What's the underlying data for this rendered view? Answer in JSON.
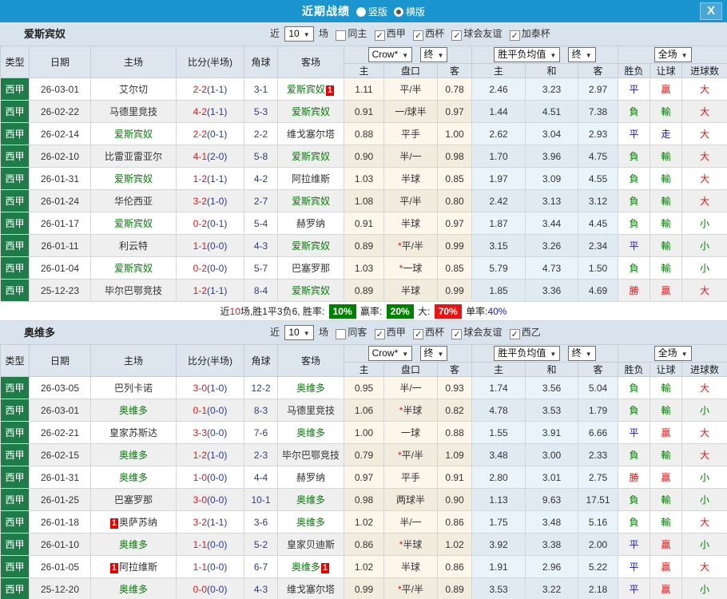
{
  "titlebar": {
    "title": "近期战绩",
    "radios": [
      {
        "label": "竖版",
        "checked": false
      },
      {
        "label": "横版",
        "checked": true
      }
    ],
    "close_label": "X"
  },
  "table_header": {
    "left_cols": [
      "类型",
      "日期",
      "主场",
      "比分(半场)",
      "角球",
      "客场"
    ],
    "odds_select": "Crow*",
    "odds_final_select": "终",
    "odds_cols": [
      "主",
      "盘口",
      "客"
    ],
    "avg_select": "胜平负均值",
    "avg_final_select": "终",
    "avg_cols": [
      "主",
      "和",
      "客"
    ],
    "result_select": "全场",
    "result_cols": [
      "胜负",
      "让球",
      "进球数"
    ]
  },
  "sections": [
    {
      "team": "爱斯宾奴",
      "near": "近",
      "count": "10",
      "unit": "场",
      "venue_filter": {
        "label": "同主",
        "checked": false
      },
      "filters": [
        {
          "label": "西甲",
          "checked": true
        },
        {
          "label": "西杯",
          "checked": true
        },
        {
          "label": "球会友谊",
          "checked": true
        },
        {
          "label": "加泰杯",
          "checked": true
        }
      ],
      "rows": [
        {
          "lg": "西甲",
          "date": "26-03-01",
          "home": "艾尔切",
          "hb": 0,
          "score": "2-2",
          "half": "(1-1)",
          "ck": "3-1",
          "away": "爱斯宾奴",
          "ab": 1,
          "o1": "1.11",
          "hc": "平/半",
          "o2": "0.78",
          "a1": "2.46",
          "a2": "3.23",
          "a3": "2.97",
          "r": "平",
          "l": "贏",
          "g": "大"
        },
        {
          "lg": "西甲",
          "date": "26-02-22",
          "home": "马德里竞技",
          "hb": 0,
          "score": "4-2",
          "half": "(1-1)",
          "ck": "5-3",
          "away": "爱斯宾奴",
          "ab": 0,
          "o1": "0.91",
          "hc": "一/球半",
          "o2": "0.97",
          "a1": "1.44",
          "a2": "4.51",
          "a3": "7.38",
          "r": "負",
          "l": "輸",
          "g": "大"
        },
        {
          "lg": "西甲",
          "date": "26-02-14",
          "home": "爱斯宾奴",
          "hb": 0,
          "score": "2-2",
          "half": "(0-1)",
          "ck": "2-2",
          "away": "维戈塞尔塔",
          "ab": 0,
          "o1": "0.88",
          "hc": "平手",
          "o2": "1.00",
          "a1": "2.62",
          "a2": "3.04",
          "a3": "2.93",
          "r": "平",
          "l": "走",
          "g": "大"
        },
        {
          "lg": "西甲",
          "date": "26-02-10",
          "home": "比雷亚雷亚尔",
          "hb": 0,
          "score": "4-1",
          "half": "(2-0)",
          "ck": "5-8",
          "away": "爱斯宾奴",
          "ab": 0,
          "o1": "0.90",
          "hc": "半/一",
          "o2": "0.98",
          "a1": "1.70",
          "a2": "3.96",
          "a3": "4.75",
          "r": "負",
          "l": "輸",
          "g": "大"
        },
        {
          "lg": "西甲",
          "date": "26-01-31",
          "home": "爱斯宾奴",
          "hb": 0,
          "score": "1-2",
          "half": "(1-1)",
          "ck": "4-2",
          "away": "阿拉维斯",
          "ab": 0,
          "o1": "1.03",
          "hc": "半球",
          "o2": "0.85",
          "a1": "1.97",
          "a2": "3.09",
          "a3": "4.55",
          "r": "負",
          "l": "輸",
          "g": "大"
        },
        {
          "lg": "西甲",
          "date": "26-01-24",
          "home": "华伦西亚",
          "hb": 0,
          "score": "3-2",
          "half": "(1-0)",
          "ck": "2-7",
          "away": "爱斯宾奴",
          "ab": 0,
          "o1": "1.08",
          "hc": "平/半",
          "o2": "0.80",
          "a1": "2.42",
          "a2": "3.13",
          "a3": "3.12",
          "r": "負",
          "l": "輸",
          "g": "大"
        },
        {
          "lg": "西甲",
          "date": "26-01-17",
          "home": "爱斯宾奴",
          "hb": 0,
          "score": "0-2",
          "half": "(0-1)",
          "ck": "5-4",
          "away": "赫罗纳",
          "ab": 0,
          "o1": "0.91",
          "hc": "半球",
          "o2": "0.97",
          "a1": "1.87",
          "a2": "3.44",
          "a3": "4.45",
          "r": "負",
          "l": "輸",
          "g": "小"
        },
        {
          "lg": "西甲",
          "date": "26-01-11",
          "home": "利云特",
          "hb": 0,
          "score": "1-1",
          "half": "(0-0)",
          "ck": "4-3",
          "away": "爱斯宾奴",
          "ab": 0,
          "o1": "0.89",
          "hc": "*平/半",
          "o2": "0.99",
          "a1": "3.15",
          "a2": "3.26",
          "a3": "2.34",
          "r": "平",
          "l": "輸",
          "g": "小"
        },
        {
          "lg": "西甲",
          "date": "26-01-04",
          "home": "爱斯宾奴",
          "hb": 0,
          "score": "0-2",
          "half": "(0-0)",
          "ck": "5-7",
          "away": "巴塞罗那",
          "ab": 0,
          "o1": "1.03",
          "hc": "*一球",
          "o2": "0.85",
          "a1": "5.79",
          "a2": "4.73",
          "a3": "1.50",
          "r": "負",
          "l": "輸",
          "g": "小"
        },
        {
          "lg": "西甲",
          "date": "25-12-23",
          "home": "毕尔巴鄂竞技",
          "hb": 0,
          "score": "1-2",
          "half": "(1-1)",
          "ck": "8-4",
          "away": "爱斯宾奴",
          "ab": 0,
          "o1": "0.89",
          "hc": "半球",
          "o2": "0.99",
          "a1": "1.85",
          "a2": "3.36",
          "a3": "4.69",
          "r": "勝",
          "l": "贏",
          "g": "大"
        }
      ],
      "footer": {
        "p1": "近",
        "n": "10",
        "p2": "场,胜1平3负6, 胜率:",
        "win": "10%",
        "p3": "赢率:",
        "yld": "20%",
        "p4": "大:",
        "big": "70%",
        "p5": "单率:",
        "single": "40%"
      }
    },
    {
      "team": "奥维多",
      "near": "近",
      "count": "10",
      "unit": "场",
      "venue_filter": {
        "label": "同客",
        "checked": false
      },
      "filters": [
        {
          "label": "西甲",
          "checked": true
        },
        {
          "label": "西杯",
          "checked": true
        },
        {
          "label": "球会友谊",
          "checked": true
        },
        {
          "label": "西乙",
          "checked": true
        }
      ],
      "rows": [
        {
          "lg": "西甲",
          "date": "26-03-05",
          "home": "巴列卡诺",
          "hb": 0,
          "score": "3-0",
          "half": "(1-0)",
          "ck": "12-2",
          "away": "奥维多",
          "ab": 0,
          "o1": "0.95",
          "hc": "半/一",
          "o2": "0.93",
          "a1": "1.74",
          "a2": "3.56",
          "a3": "5.04",
          "r": "負",
          "l": "輸",
          "g": "大"
        },
        {
          "lg": "西甲",
          "date": "26-03-01",
          "home": "奥维多",
          "hb": 0,
          "score": "0-1",
          "half": "(0-0)",
          "ck": "8-3",
          "away": "马德里竞技",
          "ab": 0,
          "o1": "1.06",
          "hc": "*半球",
          "o2": "0.82",
          "a1": "4.78",
          "a2": "3.53",
          "a3": "1.79",
          "r": "負",
          "l": "輸",
          "g": "小"
        },
        {
          "lg": "西甲",
          "date": "26-02-21",
          "home": "皇家苏斯达",
          "hb": 0,
          "score": "3-3",
          "half": "(0-0)",
          "ck": "7-6",
          "away": "奥维多",
          "ab": 0,
          "o1": "1.00",
          "hc": "一球",
          "o2": "0.88",
          "a1": "1.55",
          "a2": "3.91",
          "a3": "6.66",
          "r": "平",
          "l": "贏",
          "g": "大"
        },
        {
          "lg": "西甲",
          "date": "26-02-15",
          "home": "奥维多",
          "hb": 0,
          "score": "1-2",
          "half": "(1-0)",
          "ck": "2-3",
          "away": "毕尔巴鄂竞技",
          "ab": 0,
          "o1": "0.79",
          "hc": "*平/半",
          "o2": "1.09",
          "a1": "3.48",
          "a2": "3.00",
          "a3": "2.33",
          "r": "負",
          "l": "輸",
          "g": "大"
        },
        {
          "lg": "西甲",
          "date": "26-01-31",
          "home": "奥维多",
          "hb": 0,
          "score": "1-0",
          "half": "(0-0)",
          "ck": "4-4",
          "away": "赫罗纳",
          "ab": 0,
          "o1": "0.97",
          "hc": "平手",
          "o2": "0.91",
          "a1": "2.80",
          "a2": "3.01",
          "a3": "2.75",
          "r": "勝",
          "l": "贏",
          "g": "小"
        },
        {
          "lg": "西甲",
          "date": "26-01-25",
          "home": "巴塞罗那",
          "hb": 0,
          "score": "3-0",
          "half": "(0-0)",
          "ck": "10-1",
          "away": "奥维多",
          "ab": 0,
          "o1": "0.98",
          "hc": "两球半",
          "o2": "0.90",
          "a1": "1.13",
          "a2": "9.63",
          "a3": "17.51",
          "r": "負",
          "l": "輸",
          "g": "小"
        },
        {
          "lg": "西甲",
          "date": "26-01-18",
          "home": "奥萨苏纳",
          "hb": 1,
          "score": "3-2",
          "half": "(1-1)",
          "ck": "3-6",
          "away": "奥维多",
          "ab": 0,
          "o1": "1.02",
          "hc": "半/一",
          "o2": "0.86",
          "a1": "1.75",
          "a2": "3.48",
          "a3": "5.16",
          "r": "負",
          "l": "輸",
          "g": "大"
        },
        {
          "lg": "西甲",
          "date": "26-01-10",
          "home": "奥维多",
          "hb": 0,
          "score": "1-1",
          "half": "(0-0)",
          "ck": "5-2",
          "away": "皇家贝迪斯",
          "ab": 0,
          "o1": "0.86",
          "hc": "*半球",
          "o2": "1.02",
          "a1": "3.92",
          "a2": "3.38",
          "a3": "2.00",
          "r": "平",
          "l": "贏",
          "g": "小"
        },
        {
          "lg": "西甲",
          "date": "26-01-05",
          "home": "阿拉维斯",
          "hb": 1,
          "score": "1-1",
          "half": "(0-0)",
          "ck": "6-7",
          "away": "奥维多",
          "ab": 1,
          "o1": "1.02",
          "hc": "半球",
          "o2": "0.86",
          "a1": "1.91",
          "a2": "2.96",
          "a3": "5.22",
          "r": "平",
          "l": "贏",
          "g": "大"
        },
        {
          "lg": "西甲",
          "date": "25-12-20",
          "home": "奥维多",
          "hb": 0,
          "score": "0-0",
          "half": "(0-0)",
          "ck": "4-3",
          "away": "维戈塞尔塔",
          "ab": 0,
          "o1": "0.99",
          "hc": "*平/半",
          "o2": "0.89",
          "a1": "3.53",
          "a2": "3.22",
          "a3": "2.18",
          "r": "平",
          "l": "贏",
          "g": "小"
        }
      ]
    }
  ]
}
